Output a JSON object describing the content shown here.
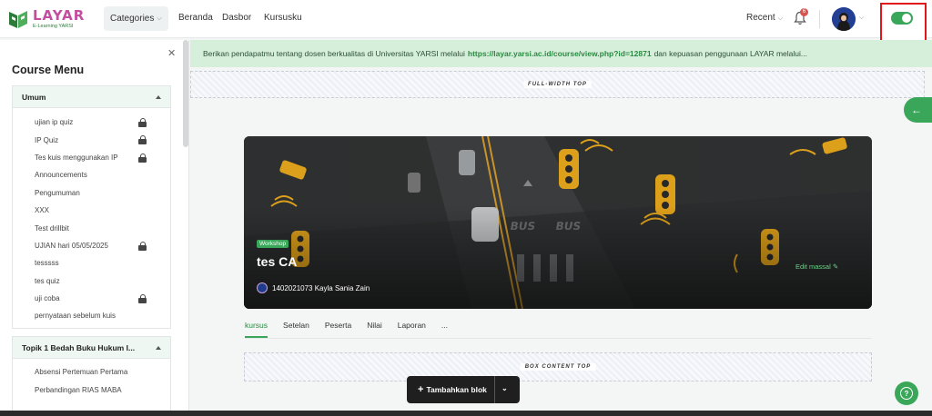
{
  "logo": {
    "title": "LAYAR",
    "subtitle": "E-Learning YARSI"
  },
  "nav": {
    "categories": "Categories",
    "links": [
      "Beranda",
      "Dasbor",
      "Kursusku"
    ],
    "recent": "Recent",
    "notification_count": "6"
  },
  "sidebar": {
    "title": "Course Menu",
    "sections": [
      {
        "title": "Umum",
        "items": [
          {
            "label": "ujian ip quiz",
            "locked": true
          },
          {
            "label": "IP Quiz",
            "locked": true
          },
          {
            "label": "Tes kuis menggunakan IP",
            "locked": true
          },
          {
            "label": "Announcements",
            "locked": false
          },
          {
            "label": "Pengumuman",
            "locked": false
          },
          {
            "label": "XXX",
            "locked": false
          },
          {
            "label": "Test drillbit",
            "locked": false
          },
          {
            "label": "UJIAN hari 05/05/2025",
            "locked": true
          },
          {
            "label": "tesssss",
            "locked": false
          },
          {
            "label": "tes quiz",
            "locked": false
          },
          {
            "label": "uji coba",
            "locked": true
          },
          {
            "label": "pernyataan sebelum kuis",
            "locked": false
          }
        ]
      },
      {
        "title": "Topik 1 Bedah Buku Hukum I...",
        "items": [
          {
            "label": "Absensi Pertemuan Pertama",
            "locked": false
          },
          {
            "label": "Perbandingan RIAS MABA",
            "locked": false
          }
        ]
      }
    ]
  },
  "alert": {
    "prefix": "Berikan pendapatmu tentang dosen berkualitas di Universitas YARSI melalui",
    "link": "https://layar.yarsi.ac.id/course/view.php?id=12871",
    "suffix": "dan kepuasan penggunaan LAYAR melalui..."
  },
  "blocks": {
    "full_width_top": "FULL-WIDTH TOP",
    "box_content_top": "BOX CONTENT TOP"
  },
  "course": {
    "badge": "Workshop",
    "title": "tes CA",
    "teacher": "1402021073 Kayla Sania Zain",
    "edit": "Edit massal"
  },
  "tabs": [
    "kursus",
    "Setelan",
    "Peserta",
    "Nilai",
    "Laporan",
    "..."
  ],
  "active_tab": "kursus",
  "add_block": "Tambahkan blok",
  "colors": {
    "accent": "#3aa65a",
    "brand_pink": "#c34ea0",
    "highlight_box": "#e0161b"
  },
  "toggle_state": "on"
}
